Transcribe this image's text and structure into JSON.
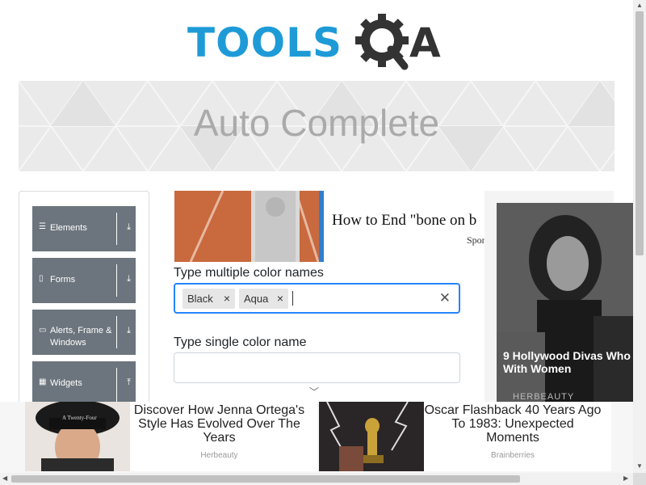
{
  "logo": {
    "text_tools": "TOOLS",
    "text_qa_suffix": "A",
    "colors": {
      "tools": "#1e9bd7",
      "gear": "#333333"
    }
  },
  "banner": {
    "title": "Auto Complete"
  },
  "sidebar": {
    "groups": [
      {
        "label": "Elements",
        "icon": "hamburger-icon",
        "arrow": "download-arrow-icon"
      },
      {
        "label": "Forms",
        "icon": "document-icon",
        "arrow": "download-arrow-icon"
      },
      {
        "label": "Alerts, Frame & Windows",
        "icon": "window-icon",
        "arrow": "download-arrow-icon"
      },
      {
        "label": "Widgets",
        "icon": "grid-icon",
        "arrow": "upload-arrow-icon"
      }
    ]
  },
  "ad_top": {
    "title": "How to End \"bone on b",
    "sponsor": "Spon"
  },
  "form": {
    "multi": {
      "label": "Type multiple color names",
      "chips": [
        "Black",
        "Aqua"
      ],
      "chip_remove_glyph": "×",
      "clear_glyph": "✕",
      "focused_color": "#2684ff"
    },
    "single": {
      "label": "Type single color name",
      "value": ""
    }
  },
  "ad_right": {
    "title_line1": "9 Hollywood Divas Who",
    "title_line2": "With Women",
    "sponsor": "HERBEAUTY"
  },
  "bottom_ads": [
    {
      "title": "Discover How Jenna Ortega's Style Has Evolved Over The Years",
      "source": "Herbeauty",
      "hat_text": "A Twenty-Four"
    },
    {
      "title": "Oscar Flashback 40 Years Ago To 1983: Unexpected Moments",
      "source": "Brainberries"
    }
  ],
  "colors": {
    "accent": "#2684ff",
    "sidebar_group": "#6c757d",
    "banner_title": "#aaaaaa"
  }
}
